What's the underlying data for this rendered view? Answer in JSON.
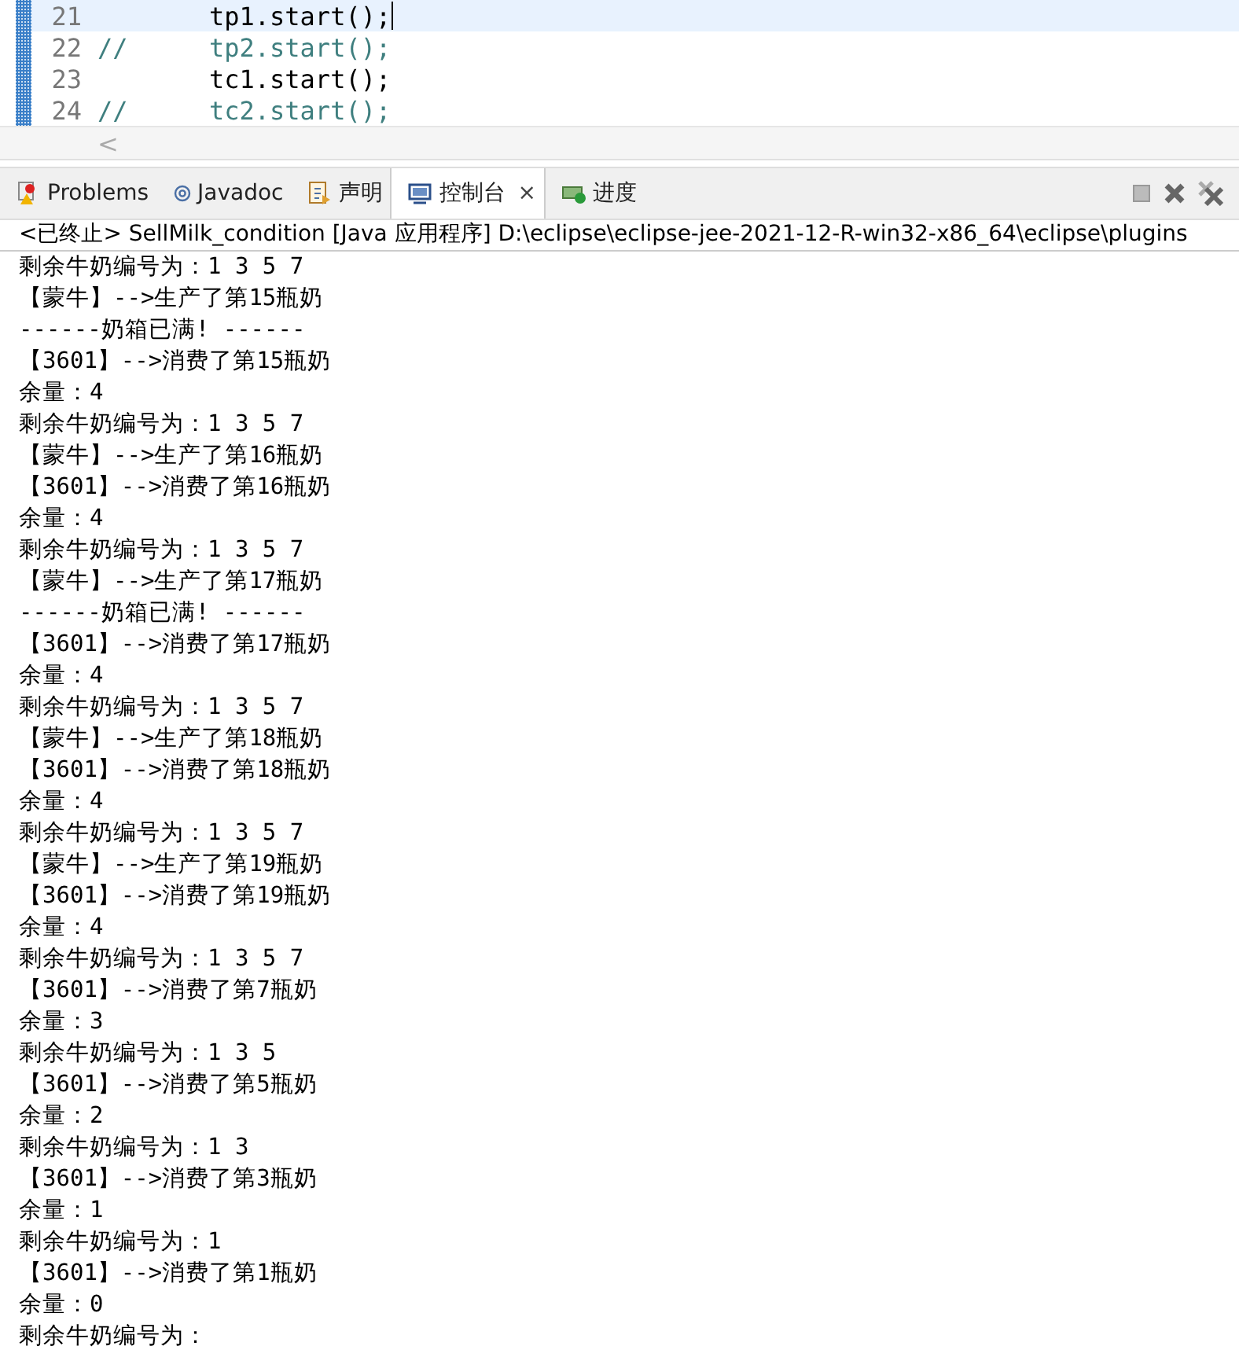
{
  "editor": {
    "lines": [
      {
        "number": "21",
        "code": "tp1.start();",
        "commented": false,
        "current": true
      },
      {
        "number": "22",
        "comment_mark": "//",
        "code": "tp2.start();",
        "commented": true,
        "current": false
      },
      {
        "number": "23",
        "code": "tc1.start();",
        "commented": false,
        "current": false
      },
      {
        "number": "24",
        "comment_mark": "//",
        "code": "tc2.start();",
        "commented": true,
        "current": false
      }
    ],
    "scroll_left": "<"
  },
  "tabs": [
    {
      "label": "Problems",
      "kind": "problems",
      "selected": false
    },
    {
      "label": "Javadoc",
      "kind": "javadoc",
      "selected": false
    },
    {
      "label": "声明",
      "kind": "declaration",
      "selected": false
    },
    {
      "label": "控制台",
      "kind": "console",
      "selected": true,
      "close": "×"
    },
    {
      "label": "进度",
      "kind": "progress",
      "selected": false
    }
  ],
  "toolbar": [
    {
      "kind": "terminate",
      "disabled": true
    },
    {
      "kind": "remove",
      "disabled": false
    },
    {
      "kind": "remove-all",
      "disabled": false
    }
  ],
  "console": {
    "header": "<已终止> SellMilk_condition [Java 应用程序] D:\\eclipse\\eclipse-jee-2021-12-R-win32-x86_64\\eclipse\\plugins",
    "lines": [
      "剩余牛奶编号为：1 3 5 7",
      "【蒙牛】-->生产了第15瓶奶",
      "------奶箱已满! ------",
      "【3601】-->消费了第15瓶奶",
      "余量：4",
      "剩余牛奶编号为：1 3 5 7",
      "【蒙牛】-->生产了第16瓶奶",
      "【3601】-->消费了第16瓶奶",
      "余量：4",
      "剩余牛奶编号为：1 3 5 7",
      "【蒙牛】-->生产了第17瓶奶",
      "------奶箱已满! ------",
      "【3601】-->消费了第17瓶奶",
      "余量：4",
      "剩余牛奶编号为：1 3 5 7",
      "【蒙牛】-->生产了第18瓶奶",
      "【3601】-->消费了第18瓶奶",
      "余量：4",
      "剩余牛奶编号为：1 3 5 7",
      "【蒙牛】-->生产了第19瓶奶",
      "【3601】-->消费了第19瓶奶",
      "余量：4",
      "剩余牛奶编号为：1 3 5 7",
      "【3601】-->消费了第7瓶奶",
      "余量：3",
      "剩余牛奶编号为：1 3 5",
      "【3601】-->消费了第5瓶奶",
      "余量：2",
      "剩余牛奶编号为：1 3",
      "【3601】-->消费了第3瓶奶",
      "余量：1",
      "剩余牛奶编号为：1",
      "【3601】-->消费了第1瓶奶",
      "余量：0",
      "剩余牛奶编号为："
    ]
  }
}
